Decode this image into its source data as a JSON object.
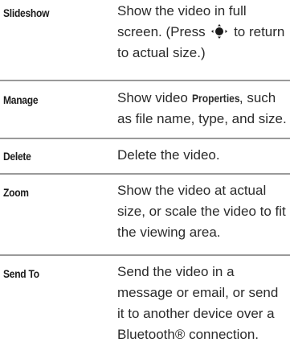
{
  "rows": [
    {
      "term": "Slideshow",
      "desc_before_icon": "Show the video in full screen. (Press",
      "icon": "navigation-key-icon",
      "desc_after_icon": "to return to actual size.)"
    },
    {
      "term": "Manage",
      "desc_prefix": "Show video",
      "desc_bold": "Properties",
      "desc_suffix": ", such as file name, type, and size."
    },
    {
      "term": "Delete",
      "desc": "Delete the video."
    },
    {
      "term": "Zoom",
      "desc": "Show the video at actual size, or scale the video to fit the viewing area."
    },
    {
      "term": "Send To",
      "desc": "Send the video in a message or email, or send it to another device over a Bluetooth® connection."
    }
  ]
}
